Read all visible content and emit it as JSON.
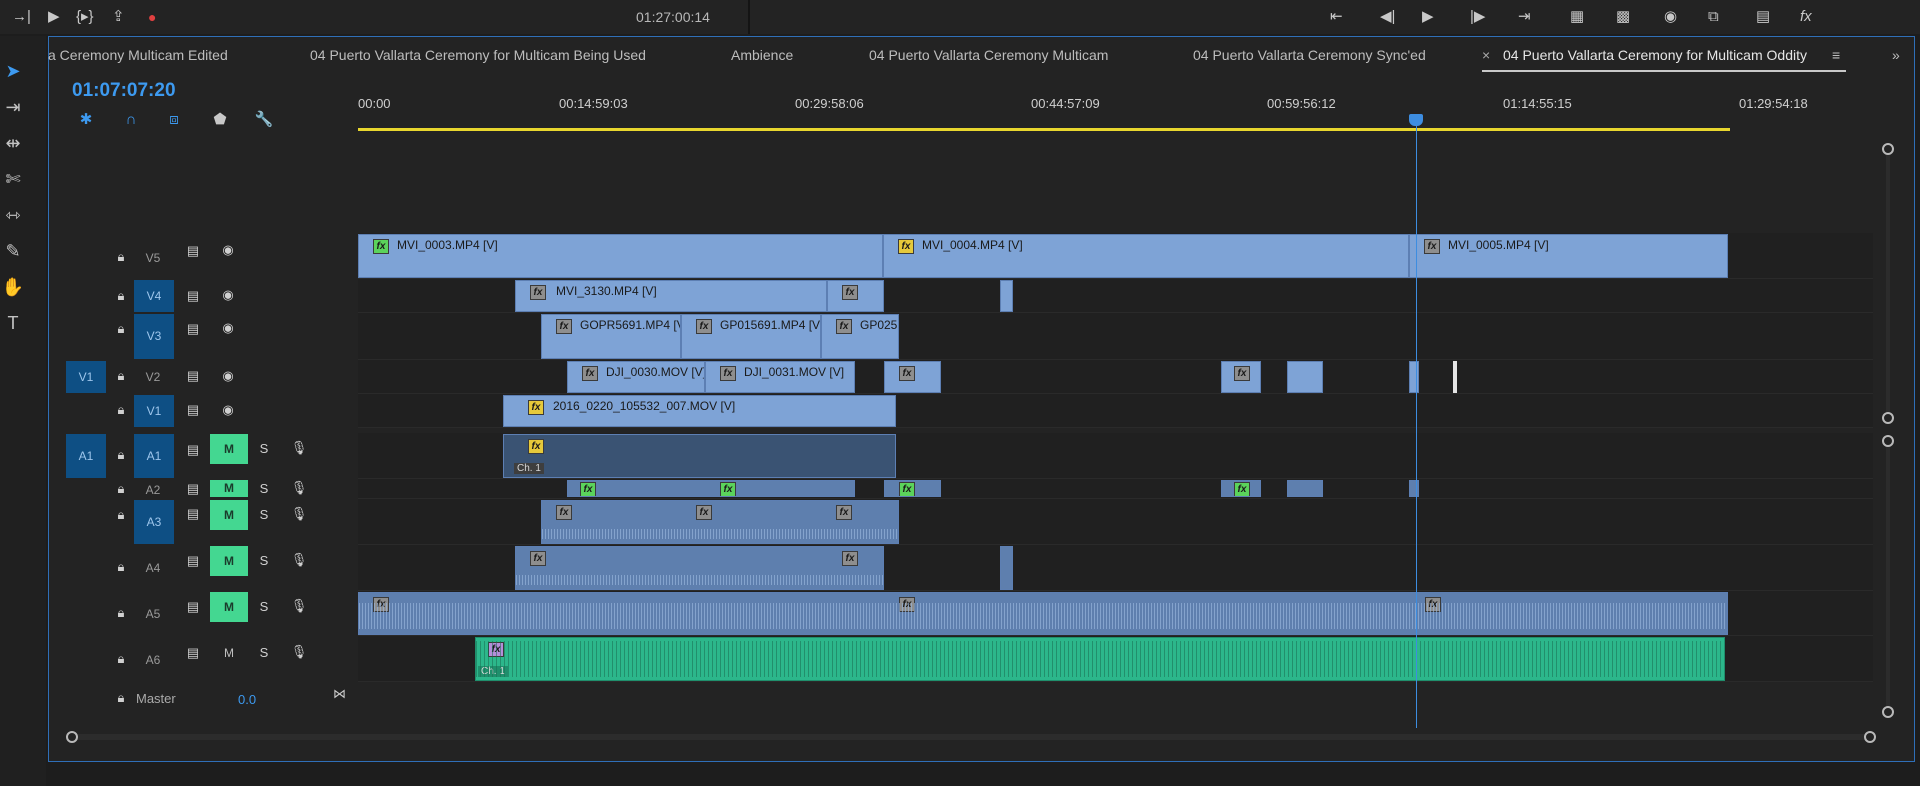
{
  "top_bar": {
    "timecode": "01:27:00:14",
    "icons": [
      "insert-icon",
      "play-icon",
      "in-out-icon",
      "export-frame-icon",
      "record-icon"
    ]
  },
  "tabs": [
    {
      "label": "a Ceremony Multicam Edited"
    },
    {
      "label": "04 Puerto Vallarta Ceremony for Multicam Being Used"
    },
    {
      "label": "Ambience"
    },
    {
      "label": "04 Puerto Vallarta Ceremony Multicam"
    },
    {
      "label": "04 Puerto Vallarta Ceremony Sync'ed"
    },
    {
      "label": "04 Puerto Vallarta Ceremony for Multicam Oddity",
      "active": true
    }
  ],
  "tab_close": "×",
  "tab_menu": "≡",
  "overflow": "»",
  "timeline": {
    "timecode": "01:07:07:20",
    "ruler": [
      "00:00",
      "00:14:59:03",
      "00:29:58:06",
      "00:44:57:09",
      "00:59:56:12",
      "01:14:55:15",
      "01:29:54:18"
    ]
  },
  "tracks": {
    "video": [
      {
        "name": "V5",
        "source": ""
      },
      {
        "name": "V4",
        "source": ""
      },
      {
        "name": "V3",
        "source": ""
      },
      {
        "name": "V2",
        "source": "V1"
      },
      {
        "name": "V1",
        "source": ""
      }
    ],
    "audio": [
      {
        "name": "A1",
        "source": "A1",
        "m": "M",
        "s": "S"
      },
      {
        "name": "A2",
        "m": "M",
        "s": "S"
      },
      {
        "name": "A3",
        "m": "M",
        "s": "S"
      },
      {
        "name": "A4",
        "m": "M",
        "s": "S"
      },
      {
        "name": "A5",
        "m": "M",
        "s": "S"
      },
      {
        "name": "A6",
        "m": "M",
        "s": "S"
      }
    ],
    "master": {
      "label": "Master",
      "value": "0.0"
    }
  },
  "clips": {
    "v5_a": "MVI_0003.MP4 [V]",
    "v5_b": "MVI_0004.MP4 [V]",
    "v5_c": "MVI_0005.MP4 [V]",
    "v4_a": "MVI_3130.MP4 [V]",
    "v3_a": "GOPR5691.MP4 [V]",
    "v3_b": "GP015691.MP4 [V]",
    "v3_c": "GP025",
    "v2_a": "DJI_0030.MOV [V]",
    "v2_b": "DJI_0031.MOV [V]",
    "v1_a": "2016_0220_105532_007.MOV [V]",
    "fx": "fx",
    "ch1": "Ch. 1"
  },
  "colors": {
    "accent": "#3d9af0",
    "ruler_bar": "#e8d62e",
    "video_clip": "#7ea3d6",
    "audio_clip": "#5e7fae",
    "ambience_clip": "#2cb78b",
    "mute_on": "#44d791"
  }
}
